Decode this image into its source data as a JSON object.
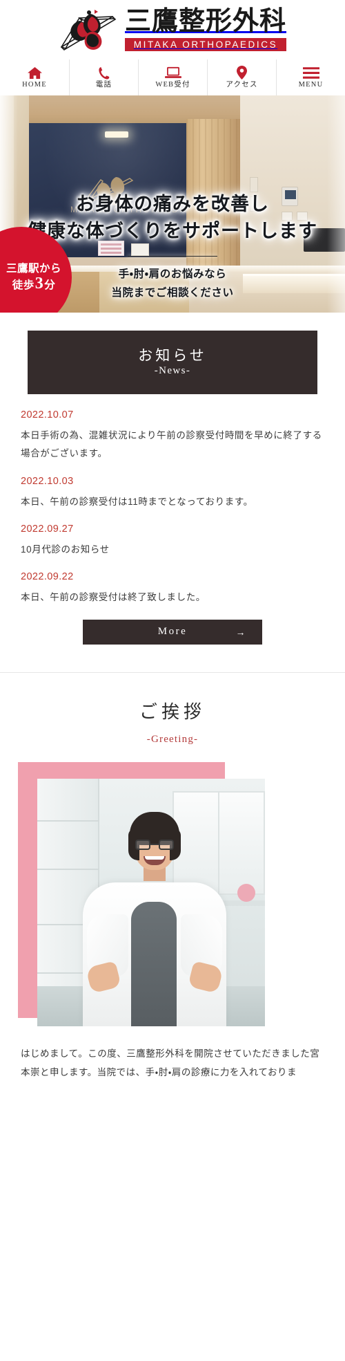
{
  "header": {
    "logo_jp": "三鷹整形外科",
    "logo_en": "MITAKA ORTHOPAEDICS",
    "logo_mark": "eagle-triangle-logo-icon"
  },
  "nav": {
    "items": [
      {
        "label": "HOME",
        "icon": "home-icon"
      },
      {
        "label": "電話",
        "icon": "phone-icon"
      },
      {
        "label": "WEB受付",
        "icon": "laptop-icon"
      },
      {
        "label": "アクセス",
        "icon": "map-pin-icon"
      },
      {
        "label": "MENU",
        "icon": "hamburger-menu-icon"
      }
    ]
  },
  "hero": {
    "badge": {
      "line1": "三鷹駅から",
      "line2_prefix": "徒歩",
      "line2_number": "3",
      "line2_suffix": "分"
    },
    "heading_line1": "お身体の痛みを改善し",
    "heading_line2": "健康な体づくりをサポートします",
    "sub_line1": "手・肘・肩のお悩みなら",
    "sub_line2": "当院までご相談ください",
    "wall_sign_text": "MITAKA ORTHOPAEDICS"
  },
  "news": {
    "title_jp": "お知らせ",
    "title_en": "-News-",
    "items": [
      {
        "date": "2022.10.07",
        "text": "本日手術の為、混雑状況により午前の診察受付時間を早めに終了する場合がございます。"
      },
      {
        "date": "2022.10.03",
        "text": "本日、午前の診察受付は11時までとなっております。"
      },
      {
        "date": "2022.09.27",
        "text": "10月代診のお知らせ"
      },
      {
        "date": "2022.09.22",
        "text": "本日、午前の診察受付は終了致しました。"
      }
    ],
    "more_label": "More",
    "more_arrow": "→"
  },
  "greeting": {
    "title_jp": "ご挨拶",
    "title_en": "-Greeting-",
    "photo_alt": "doctor-portrait",
    "body": "はじめまして。この度、三鷹整形外科を開院させていただきました宮本崇と申します。当院では、手・肘・肩の診療に力を入れておりま"
  },
  "colors": {
    "brand_red": "#c1202f",
    "badge_red": "#d4132d",
    "news_date_red": "#c0392f",
    "dark_panel": "#352c2c",
    "accent_pink": "#f0a0ae",
    "greeting_sub_red": "#b33a3a"
  }
}
